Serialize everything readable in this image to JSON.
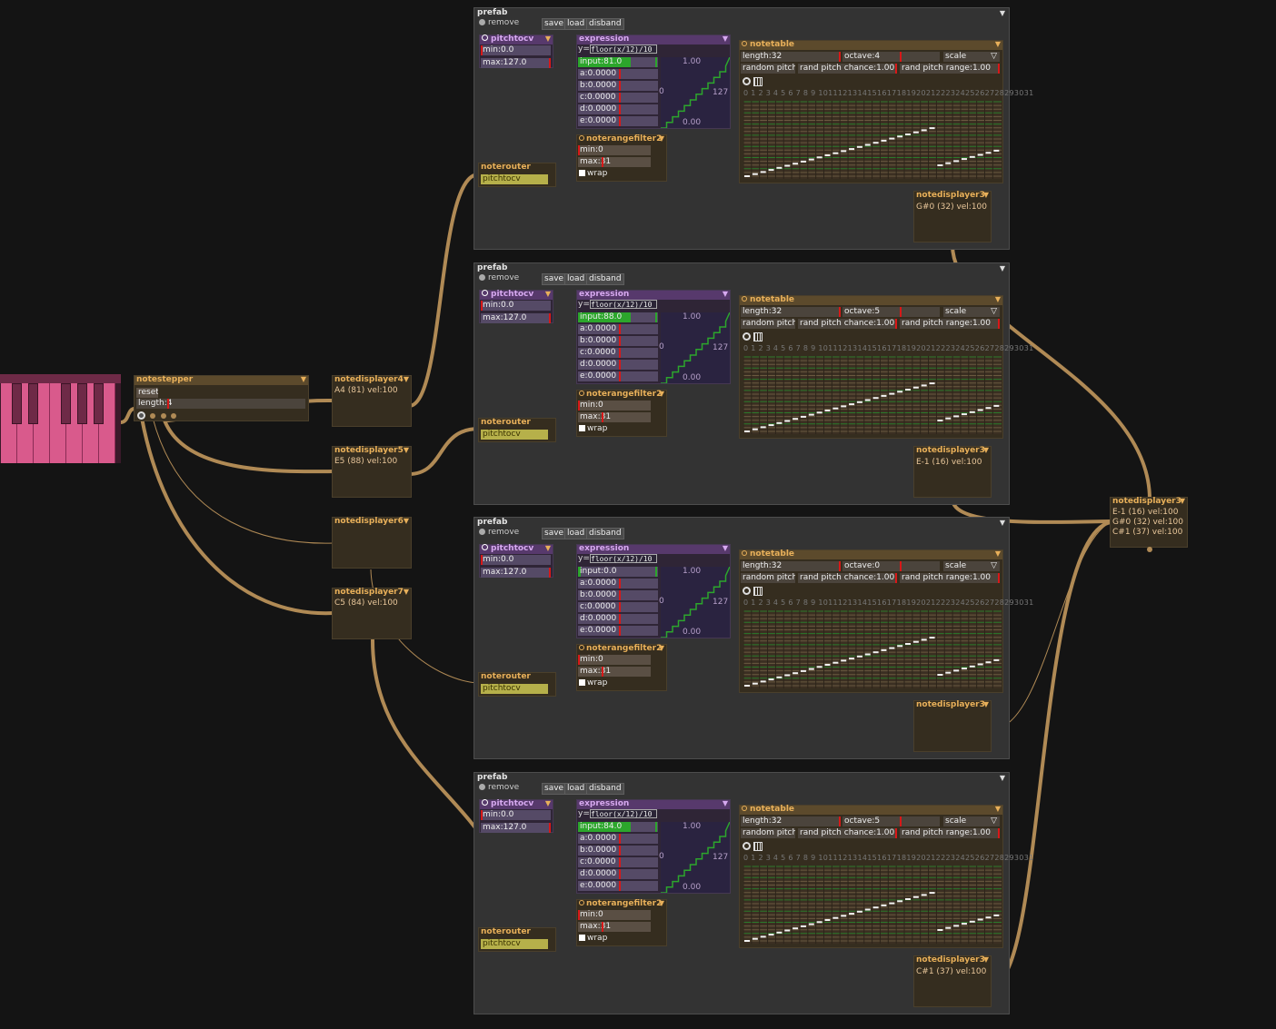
{
  "prefabs": [
    {
      "title": "prefab",
      "remove": "remove",
      "save": "save",
      "load": "load",
      "disband": "disband",
      "pitchtocv": {
        "title": "pitchtocv",
        "min": "min:0.0",
        "max": "max:127.0"
      },
      "expression": {
        "title": "expression",
        "formula_prefix": "y=",
        "formula": "floor(x/12)/10",
        "input": "input:81.0",
        "a": "a:0.0000",
        "b": "b:0.0000",
        "c": "c:0.0000",
        "d": "d:0.0000",
        "e": "e:0.0000",
        "ytop": "1.00",
        "ybot": "0.00",
        "xleft": "0",
        "xright": "127"
      },
      "noterangefilter": {
        "title": "noterangefilter2",
        "min": "min:0",
        "max": "max:31",
        "wrap": "wrap"
      },
      "noterouter": {
        "title": "noterouter",
        "target": "pitchtocv"
      },
      "notetable": {
        "title": "notetable",
        "length": "length:32",
        "octave": "octave:4",
        "scale": "scale",
        "random_pitch": "random pitch",
        "rand_pitch_chance": "rand pitch chance:1.00",
        "rand_pitch_range": "rand pitch range:1.00",
        "columns": "0 1 2 3 4 5 6 7 8 9 10111213141516171819202122232425262728293031"
      },
      "notedisplayer": {
        "title": "notedisplayer3",
        "value": "G#0 (32) vel:100"
      }
    },
    {
      "title": "prefab",
      "remove": "remove",
      "save": "save",
      "load": "load",
      "disband": "disband",
      "pitchtocv": {
        "title": "pitchtocv",
        "min": "min:0.0",
        "max": "max:127.0"
      },
      "expression": {
        "title": "expression",
        "formula_prefix": "y=",
        "formula": "floor(x/12)/10",
        "input": "input:88.0",
        "a": "a:0.0000",
        "b": "b:0.0000",
        "c": "c:0.0000",
        "d": "d:0.0000",
        "e": "e:0.0000",
        "ytop": "1.00",
        "ybot": "0.00",
        "xleft": "0",
        "xright": "127"
      },
      "noterangefilter": {
        "title": "noterangefilter2",
        "min": "min:0",
        "max": "max:31",
        "wrap": "wrap"
      },
      "noterouter": {
        "title": "noterouter",
        "target": "pitchtocv"
      },
      "notetable": {
        "title": "notetable",
        "length": "length:32",
        "octave": "octave:5",
        "scale": "scale",
        "random_pitch": "random pitch",
        "rand_pitch_chance": "rand pitch chance:1.00",
        "rand_pitch_range": "rand pitch range:1.00",
        "columns": "0 1 2 3 4 5 6 7 8 9 10111213141516171819202122232425262728293031"
      },
      "notedisplayer": {
        "title": "notedisplayer3",
        "value": "E-1 (16) vel:100"
      }
    },
    {
      "title": "prefab",
      "remove": "remove",
      "save": "save",
      "load": "load",
      "disband": "disband",
      "pitchtocv": {
        "title": "pitchtocv",
        "min": "min:0.0",
        "max": "max:127.0"
      },
      "expression": {
        "title": "expression",
        "formula_prefix": "y=",
        "formula": "floor(x/12)/10",
        "input": "input:0.0",
        "a": "a:0.0000",
        "b": "b:0.0000",
        "c": "c:0.0000",
        "d": "d:0.0000",
        "e": "e:0.0000",
        "ytop": "1.00",
        "ybot": "0.00",
        "xleft": "0",
        "xright": "127"
      },
      "noterangefilter": {
        "title": "noterangefilter2",
        "min": "min:0",
        "max": "max:31",
        "wrap": "wrap"
      },
      "noterouter": {
        "title": "noterouter",
        "target": "pitchtocv"
      },
      "notetable": {
        "title": "notetable",
        "length": "length:32",
        "octave": "octave:0",
        "scale": "scale",
        "random_pitch": "random pitch",
        "rand_pitch_chance": "rand pitch chance:1.00",
        "rand_pitch_range": "rand pitch range:1.00",
        "columns": "0 1 2 3 4 5 6 7 8 9 10111213141516171819202122232425262728293031"
      },
      "notedisplayer": {
        "title": "notedisplayer3",
        "value": ""
      }
    },
    {
      "title": "prefab",
      "remove": "remove",
      "save": "save",
      "load": "load",
      "disband": "disband",
      "pitchtocv": {
        "title": "pitchtocv",
        "min": "min:0.0",
        "max": "max:127.0"
      },
      "expression": {
        "title": "expression",
        "formula_prefix": "y=",
        "formula": "floor(x/12)/10",
        "input": "input:84.0",
        "a": "a:0.0000",
        "b": "b:0.0000",
        "c": "c:0.0000",
        "d": "d:0.0000",
        "e": "e:0.0000",
        "ytop": "1.00",
        "ybot": "0.00",
        "xleft": "0",
        "xright": "127"
      },
      "noterangefilter": {
        "title": "noterangefilter2",
        "min": "min:0",
        "max": "max:31",
        "wrap": "wrap"
      },
      "noterouter": {
        "title": "noterouter",
        "target": "pitchtocv"
      },
      "notetable": {
        "title": "notetable",
        "length": "length:32",
        "octave": "octave:5",
        "scale": "scale",
        "random_pitch": "random pitch",
        "rand_pitch_chance": "rand pitch chance:1.00",
        "rand_pitch_range": "rand pitch range:1.00",
        "columns": "0 1 2 3 4 5 6 7 8 9 10111213141516171819202122232425262728293031"
      },
      "notedisplayer": {
        "title": "notedisplayer3",
        "value": "C#1 (37) vel:100"
      }
    }
  ],
  "notestepper": {
    "title": "notestepper",
    "reset": "reset",
    "length": "length:4"
  },
  "left_displayers": [
    {
      "title": "notedisplayer4",
      "value": "A4 (81) vel:100"
    },
    {
      "title": "notedisplayer5",
      "value": "E5 (88) vel:100"
    },
    {
      "title": "notedisplayer6",
      "value": ""
    },
    {
      "title": "notedisplayer7",
      "value": "C5 (84) vel:100"
    }
  ],
  "final_displayer": {
    "title": "notedisplayer3",
    "lines": [
      "E-1 (16) vel:100",
      "G#0 (32) vel:100",
      "C#1 (37) vel:100"
    ]
  },
  "colors": {
    "background": "#141414",
    "cable": "#b08a55",
    "accent_orange": "#e8b05a",
    "accent_purple": "#d7a9f0",
    "keyboard": "#d95a8c"
  }
}
